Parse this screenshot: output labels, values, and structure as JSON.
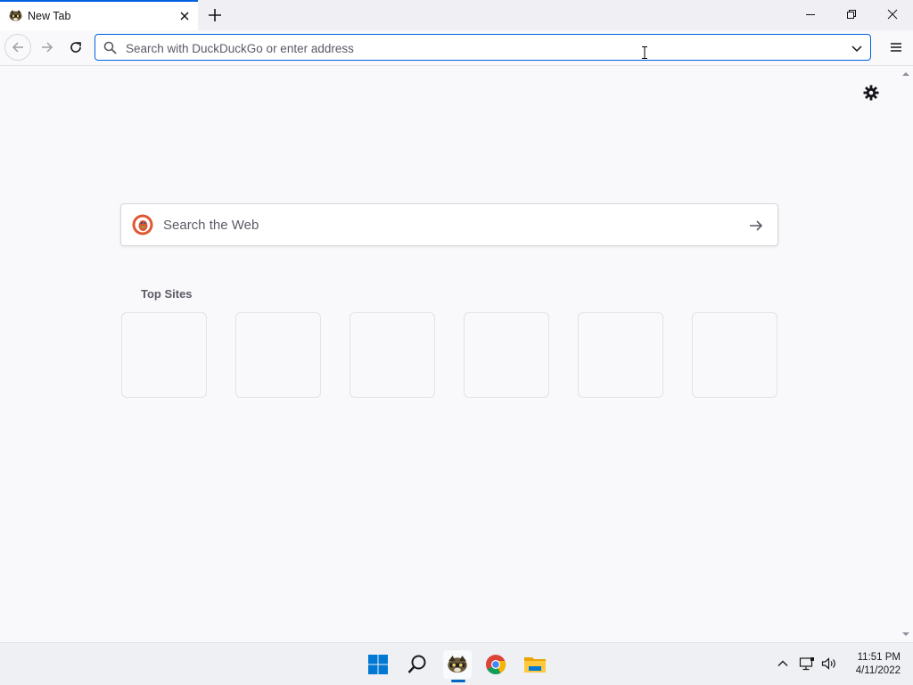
{
  "browser": {
    "tab": {
      "title": "New Tab",
      "favicon": "librewolf-raccoon-icon"
    },
    "urlbar": {
      "placeholder": "Search with DuckDuckGo or enter address",
      "value": ""
    }
  },
  "newtab": {
    "search": {
      "placeholder": "Search the Web",
      "engine_icon": "duckduckgo-icon"
    },
    "top_sites": {
      "title": "Top Sites",
      "tiles": [
        "",
        "",
        "",
        "",
        "",
        ""
      ]
    }
  },
  "taskbar": {
    "apps": [
      "windows-start-icon",
      "search-icon",
      "librewolf-icon",
      "chrome-icon",
      "file-explorer-icon"
    ],
    "clock": {
      "time": "11:51 PM",
      "date": "4/11/2022"
    }
  },
  "colors": {
    "accent": "#0061e0",
    "taskbar_accent": "#0067c0",
    "ddg_orange": "#de5833"
  }
}
